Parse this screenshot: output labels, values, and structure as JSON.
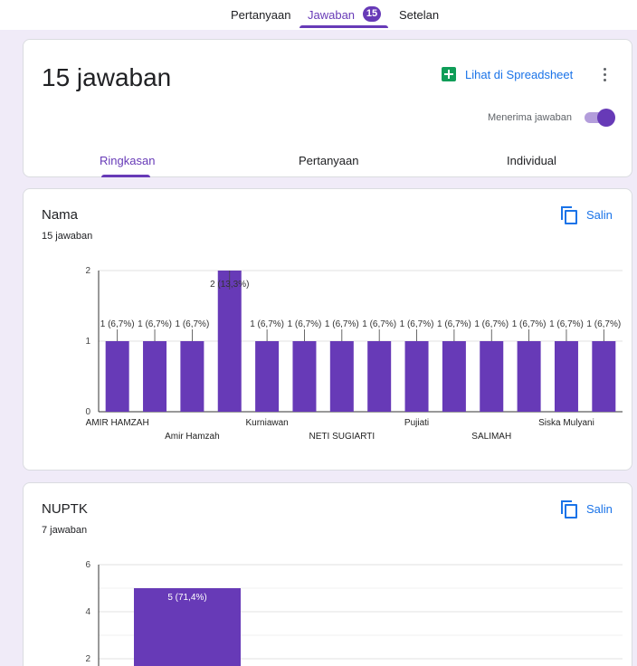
{
  "nav": {
    "tabs": [
      {
        "label": "Pertanyaan"
      },
      {
        "label": "Jawaban",
        "badge": "15"
      },
      {
        "label": "Setelan"
      }
    ]
  },
  "summary": {
    "title": "15 jawaban",
    "sheet_link": "Lihat di Spreadsheet",
    "more_icon": "more-vert-icon",
    "accepting_label": "Menerima jawaban",
    "accepting": true,
    "tabs": [
      {
        "label": "Ringkasan",
        "active": true
      },
      {
        "label": "Pertanyaan"
      },
      {
        "label": "Individual"
      }
    ]
  },
  "colors": {
    "accent": "#673ab7",
    "link": "#1a73e8",
    "sheets_green": "#0f9d58",
    "background": "#f0ebf8"
  },
  "questions": [
    {
      "title": "Nama",
      "count_label": "15 jawaban",
      "copy_label": "Salin",
      "copy_icon": "copy-icon"
    },
    {
      "title": "NUPTK",
      "count_label": "7 jawaban",
      "copy_label": "Salin",
      "copy_icon": "copy-icon"
    }
  ],
  "chart_data": [
    {
      "type": "bar",
      "title": "Nama",
      "ylim": [
        0,
        2
      ],
      "yticks": [
        "0",
        "1",
        "2"
      ],
      "grid": true,
      "categories": [
        "AMIR HAMZAH",
        "",
        "Amir Hamzah",
        "",
        "Kurniawan",
        "",
        "NETI SUGIARTI",
        "",
        "Pujiati",
        "",
        "SALIMAH",
        "",
        "Siska Mulyani",
        ""
      ],
      "values": [
        1,
        1,
        1,
        2,
        1,
        1,
        1,
        1,
        1,
        1,
        1,
        1,
        1,
        1
      ],
      "data_labels": [
        "1 (6,7%)",
        "1 (6,7%)",
        "1 (6,7%)",
        "2 (13,3%)",
        "1 (6,7%)",
        "1 (6,7%)",
        "1 (6,7%)",
        "1 (6,7%)",
        "1 (6,7%)",
        "1 (6,7%)",
        "1 (6,7%)",
        "1 (6,7%)",
        "1 (6,7%)",
        "1 (6,7%)"
      ]
    },
    {
      "type": "bar",
      "title": "NUPTK",
      "ylim": [
        0,
        6
      ],
      "yticks": [
        "2",
        "4",
        "6"
      ],
      "grid": true,
      "categories": [
        ""
      ],
      "values": [
        5
      ],
      "data_labels": [
        "5 (71,4%)"
      ]
    }
  ]
}
